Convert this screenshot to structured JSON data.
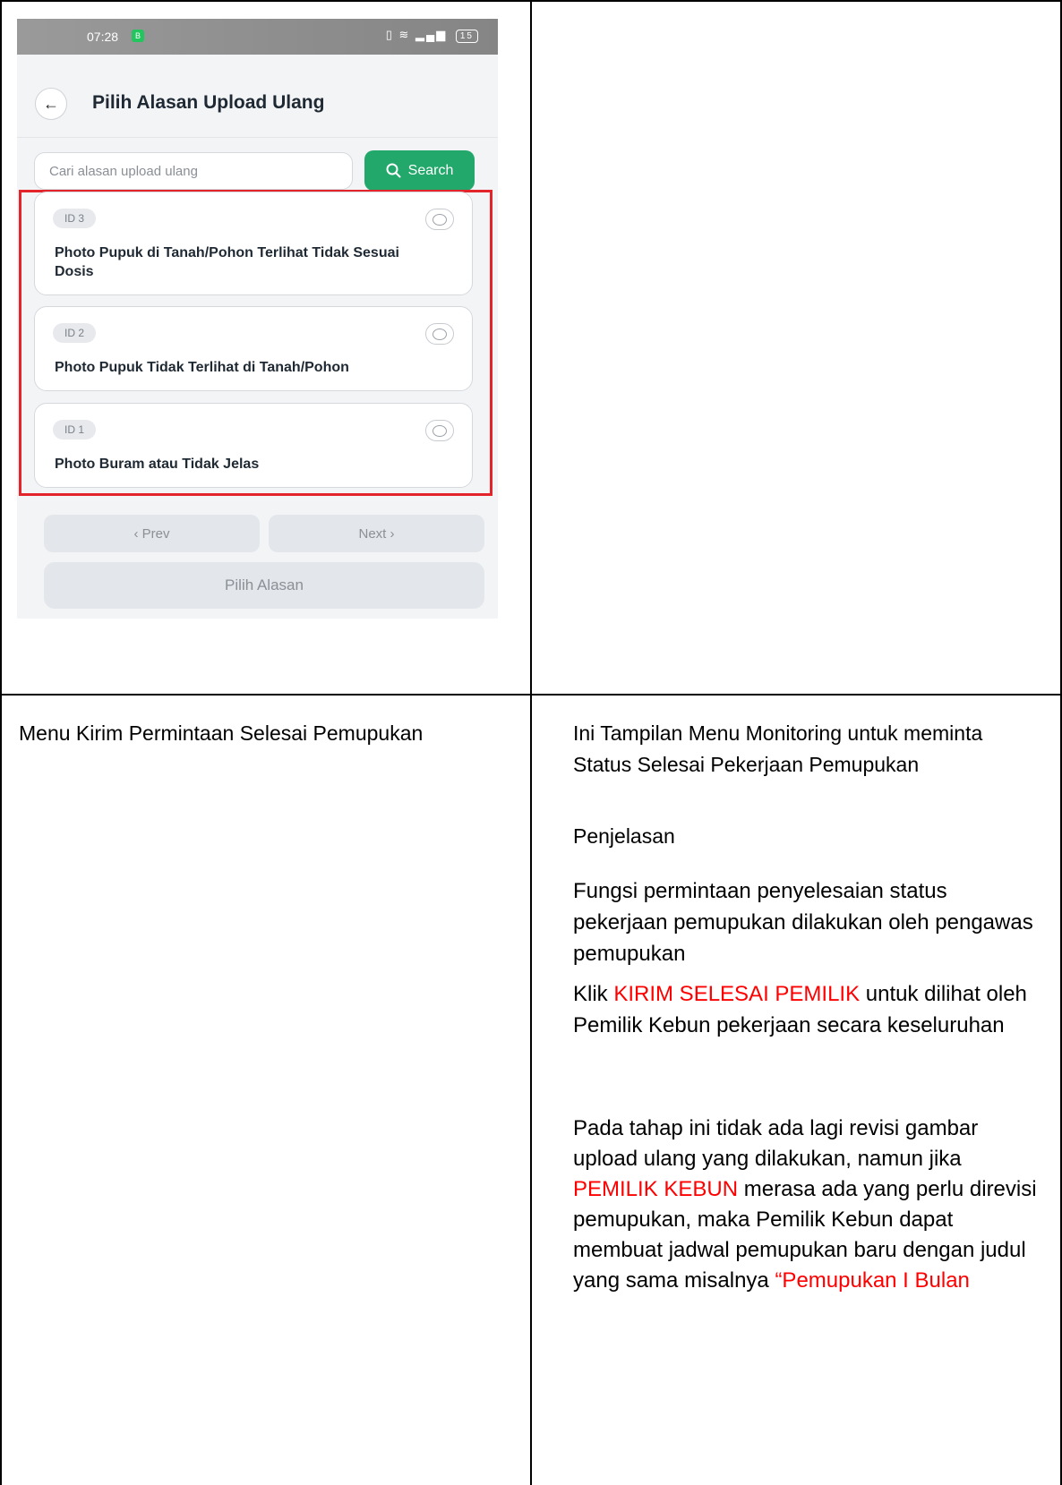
{
  "phone": {
    "status_time": "07:28",
    "status_badge": "B",
    "battery": "15",
    "title": "Pilih Alasan Upload Ulang",
    "search_placeholder": "Cari alasan upload ulang",
    "search_button": "Search",
    "reasons": [
      {
        "id": "ID 3",
        "text": "Photo Pupuk di Tanah/Pohon Terlihat Tidak Sesuai Dosis"
      },
      {
        "id": "ID 2",
        "text": "Photo Pupuk Tidak Terlihat di Tanah/Pohon"
      },
      {
        "id": "ID 1",
        "text": "Photo Buram atau Tidak Jelas"
      }
    ],
    "prev_label": "Prev",
    "next_label": "Next",
    "choose_label": "Pilih Alasan"
  },
  "doc": {
    "left_title": "Menu Kirim Permintaan Selesai Pemupukan",
    "right_title": "Ini Tampilan Menu Monitoring untuk meminta Status Selesai Pekerjaan Pemupukan",
    "section": "Penjelasan",
    "para1": "Fungsi permintaan penyelesaian status pekerjaan pemupukan dilakukan oleh pengawas pemupukan",
    "para2_prefix": "Klik ",
    "para2_highlight": "KIRIM SELESAI PEMILIK",
    "para2_suffix": " untuk dilihat oleh Pemilik Kebun pekerjaan secara keseluruhan",
    "para3_a": "Pada tahap ini tidak ada lagi revisi gambar upload ulang yang dilakukan, namun jika ",
    "para3_highlight1": "PEMILIK KEBUN",
    "para3_b": " merasa ada yang perlu direvisi pemupukan, maka Pemilik Kebun dapat membuat jadwal pemupukan baru dengan judul yang sama misalnya ",
    "para3_highlight2": "“Pemupukan I Bulan"
  },
  "colors": {
    "accent_green": "#22a86a",
    "highlight_red": "#ff0000",
    "box_red": "#e3242b"
  }
}
